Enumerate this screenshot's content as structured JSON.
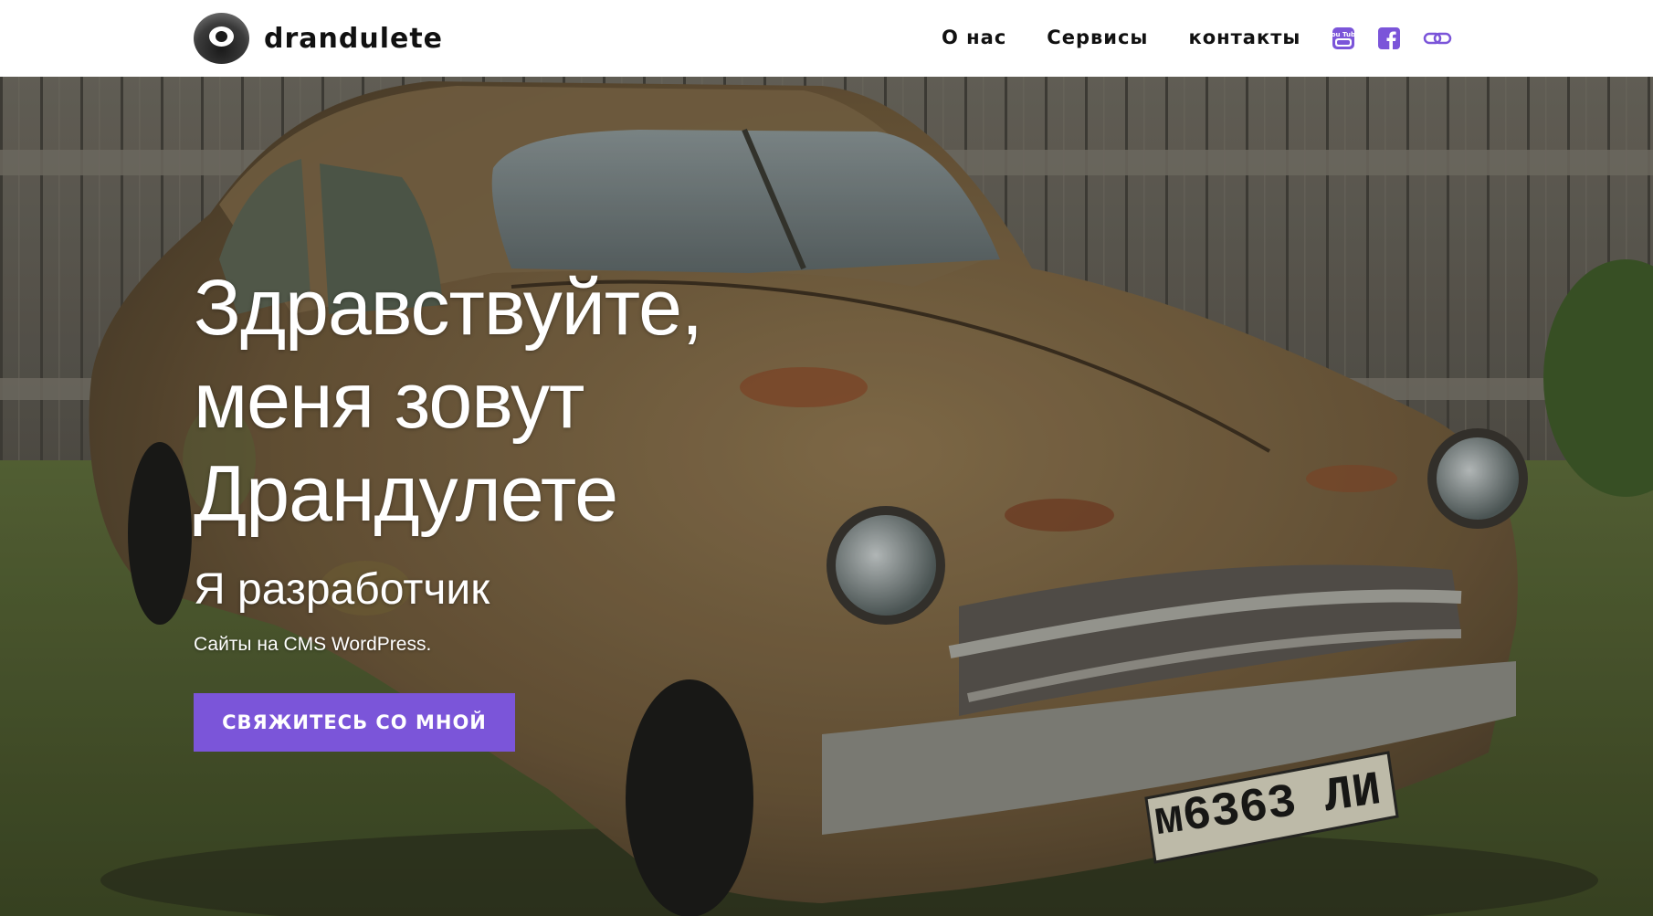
{
  "header": {
    "logo_text": "drandulete",
    "nav": [
      {
        "label": "О нас"
      },
      {
        "label": "Сервисы"
      },
      {
        "label": "контакты"
      }
    ],
    "social": [
      {
        "icon": "youtube-icon",
        "label": "You Tube",
        "color": "#7b55d9"
      },
      {
        "icon": "facebook-icon",
        "color": "#7b55d9"
      },
      {
        "icon": "link-icon",
        "color": "#7b55d9"
      }
    ]
  },
  "hero": {
    "title_lines": [
      "Здравствуйте,",
      "меня зовут",
      "Драндулете"
    ],
    "subtitle": "Я разработчик",
    "description": "Сайты на CMS WordPress.",
    "button_label": "СВЯЖИТЕСЬ СО МНОЙ",
    "plate_text": "м6363 ЛИ",
    "colors": {
      "accent": "#7b55d9",
      "text": "#ffffff"
    }
  }
}
